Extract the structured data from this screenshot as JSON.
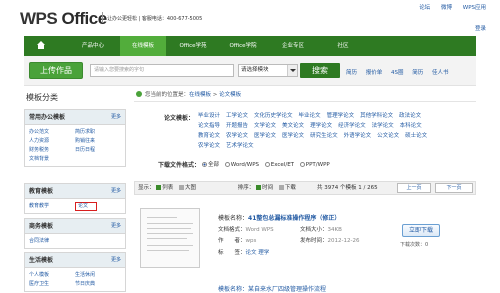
{
  "header": {
    "logo_main": "WPS",
    "logo_sub": "Office",
    "slogan": "让办公更轻松 | 客服电话：400-677-5005",
    "top_links": [
      "论坛",
      "微博",
      "WPS应用"
    ],
    "login": "登录"
  },
  "nav": {
    "items": [
      "产品中心",
      "在线模板",
      "Office学苑",
      "Office学院",
      "企业专区",
      "社区"
    ],
    "active_index": 1
  },
  "search": {
    "upload_label": "上传作品",
    "placeholder": "请输入您要搜索的字句",
    "category_value": "请选择模块",
    "search_label": "搜索",
    "hot_tags": [
      "简历",
      "报价单",
      "4S圈",
      "简历",
      "佳人书"
    ]
  },
  "sidebar": {
    "title": "模板分类",
    "panels": [
      {
        "title": "常用办公模板",
        "more": "更多",
        "items": [
          "办公范文",
          "简历求职",
          "人力资源",
          "购销往来",
          "财务税务",
          "日历日程",
          "文档背景",
          ""
        ]
      },
      {
        "title": "教育模板",
        "more": "更多",
        "items": [
          "教育教学",
          "论文"
        ]
      },
      {
        "title": "商务模板",
        "more": "更多",
        "items": [
          "合同法律",
          ""
        ]
      },
      {
        "title": "生活模板",
        "more": "更多",
        "items": [
          "个人模板",
          "生活休闲",
          "医疗卫生",
          "节日庆典"
        ]
      }
    ],
    "highlighted": "论文"
  },
  "breadcrumb": {
    "prefix": "您当前的位置是：",
    "link1": "在线模板",
    "sep": " > ",
    "link2": "论文模板"
  },
  "filters": {
    "label": "论文模板：",
    "items": [
      "毕业设计",
      "工学论文",
      "文化历史学论文",
      "毕业论文",
      "管理学论文",
      "其他学科论文",
      "政法论文",
      "论文指导",
      "开题报告",
      "文学论文",
      "美文论文",
      "理学论文",
      "经济学论文",
      "法学论文",
      "本科论文",
      "教育论文",
      "农学论文",
      "医学论文",
      "医学论文",
      "研究生论文",
      "外语学论文",
      "公文论文",
      "硕士论文",
      "农学论文",
      "艺术学论文"
    ],
    "format_label": "下载文件格式：",
    "formats": [
      "全部",
      "Word/WPS",
      "Excel/ET",
      "PPT/WPP"
    ],
    "format_selected": 0
  },
  "list_toolbar": {
    "show_label": "显示：",
    "list_label": "列表",
    "grid_label": "大图",
    "sort_label": "排序：",
    "time_label": "时间",
    "dl_label": "下载",
    "count_text": "共 3974 个模板 1 / 265",
    "prev": "上一页",
    "next": "下一页"
  },
  "documents": [
    {
      "title_prefix": "模板名称：",
      "title": "41整包总漏标准操作程序（修正）",
      "fields": [
        {
          "k": "文档格式：",
          "v": "Word WPS"
        },
        {
          "k": "文档大小：",
          "v": "34KB"
        },
        {
          "k": "作　　者：",
          "v": "wps"
        },
        {
          "k": "发布时间：",
          "v": "2012-12-26"
        },
        {
          "k": "标　　签：",
          "v": "论文  理学"
        }
      ],
      "download_label": "立即下载",
      "download_count": "下载次数：0"
    },
    {
      "title": "模板名称：某自来水厂四级管理操作流程"
    }
  ],
  "colors": {
    "nav_bg": "#2e7a22",
    "nav_active": "#52ad3b",
    "link": "#225aa3",
    "highlight_border": "#d81e1e"
  }
}
